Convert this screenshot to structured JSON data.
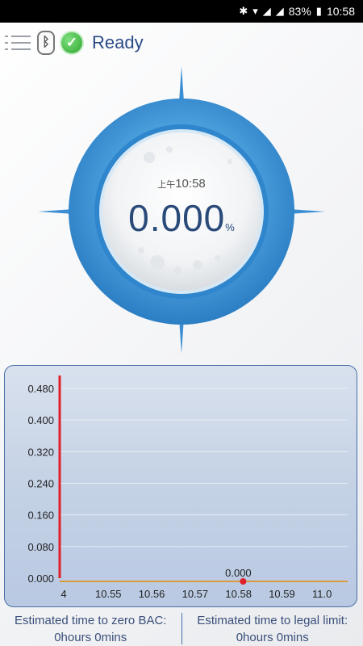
{
  "status_bar": {
    "battery": "83%",
    "time": "10:58"
  },
  "header": {
    "status_text": "Ready"
  },
  "gauge": {
    "ampm": "上午",
    "time": "10:58",
    "value": "0.000",
    "unit": "%"
  },
  "chart_data": {
    "type": "line",
    "x_tick_labels": [
      "4",
      "10.55",
      "10.56",
      "10.57",
      "10.58",
      "10.59",
      "11.0"
    ],
    "y_tick_labels": [
      "0.000",
      "0.080",
      "0.160",
      "0.240",
      "0.320",
      "0.400",
      "0.480"
    ],
    "ylim": [
      0,
      0.48
    ],
    "series": [
      {
        "points": [
          {
            "x": "10.58",
            "y": 0.0,
            "label": "0.000"
          }
        ]
      }
    ],
    "colors": {
      "baseline": "#d99a3c",
      "point": "#e0202a",
      "axis_marker": "#e0202a"
    }
  },
  "footer": {
    "zero_label": "Estimated time to zero BAC:",
    "zero_value": "0hours 0mins",
    "legal_label": "Estimated time to legal limit:",
    "legal_value": "0hours 0mins"
  }
}
